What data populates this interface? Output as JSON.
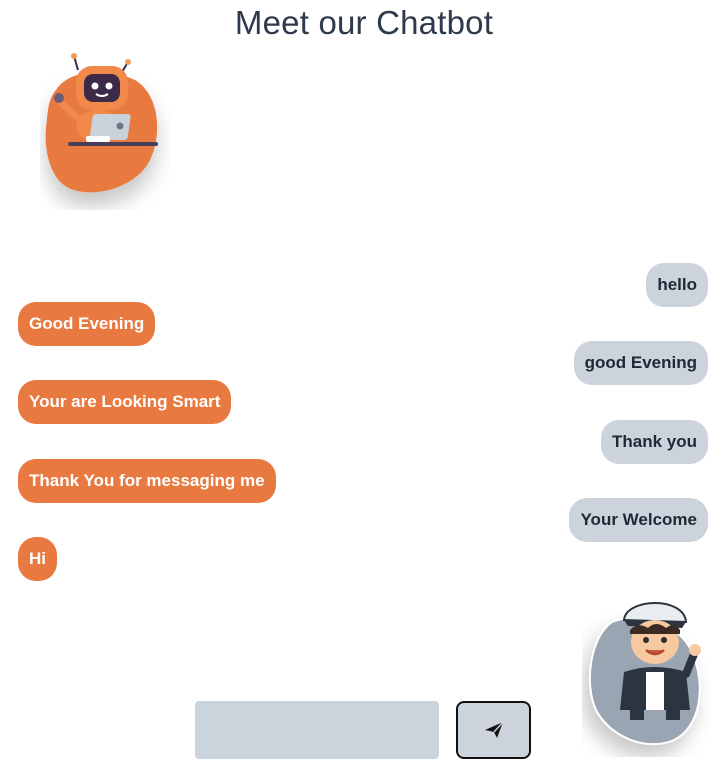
{
  "header": {
    "title": "Meet our Chatbot"
  },
  "avatars": {
    "bot_icon": "robot-with-laptop",
    "user_icon": "waving-boy-with-cap"
  },
  "colors": {
    "bot_bubble": "#e87a41",
    "user_bubble": "#cdd3dc",
    "input_bg": "#cbd3dc"
  },
  "messages": [
    {
      "sender": "user",
      "text": "hello"
    },
    {
      "sender": "bot",
      "text": "Good Evening"
    },
    {
      "sender": "user",
      "text": "good Evening"
    },
    {
      "sender": "bot",
      "text": "Your are Looking Smart"
    },
    {
      "sender": "user",
      "text": "Thank you"
    },
    {
      "sender": "bot",
      "text": "Thank You for messaging me"
    },
    {
      "sender": "user",
      "text": "Your Welcome"
    },
    {
      "sender": "bot",
      "text": "Hi"
    }
  ],
  "composer": {
    "input_value": "",
    "send_icon": "paper-plane-icon"
  }
}
